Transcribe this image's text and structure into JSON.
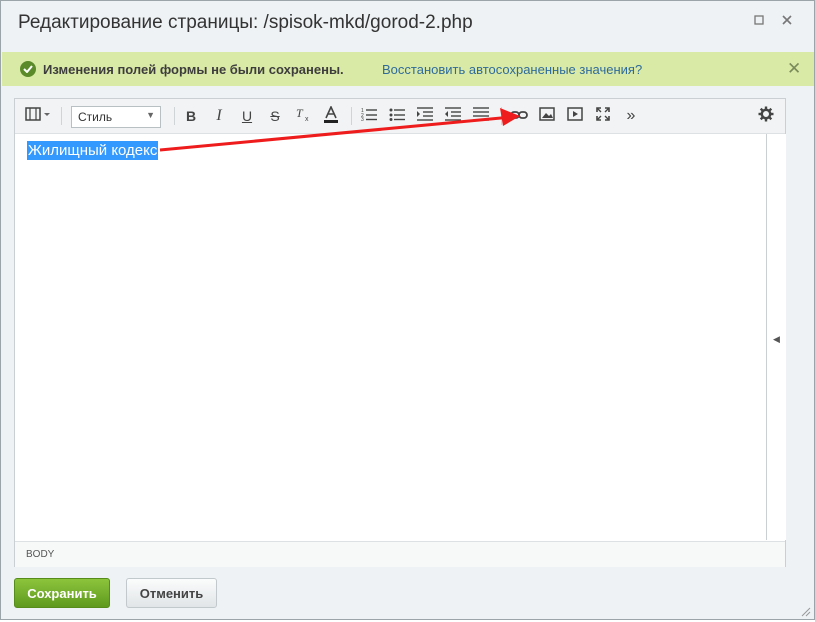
{
  "dialog": {
    "title": "Редактирование страницы: /spisok-mkd/gorod-2.php"
  },
  "notice": {
    "text": "Изменения полей формы не были сохранены.",
    "link": "Восстановить автосохраненные значения?"
  },
  "toolbar": {
    "style_select": "Стиль",
    "bold": "B",
    "italic": "I",
    "underline": "U",
    "strike": "S",
    "more": "»"
  },
  "editor": {
    "selected_text": "Жилищный кодекс"
  },
  "statusbar": {
    "path": "BODY"
  },
  "buttons": {
    "save": "Сохранить",
    "cancel": "Отменить"
  },
  "colors": {
    "notice_bg": "#d9e9a6",
    "selection": "#3399ff",
    "save_button": "#6fab26",
    "annotation_arrow": "#ee1c1c"
  }
}
